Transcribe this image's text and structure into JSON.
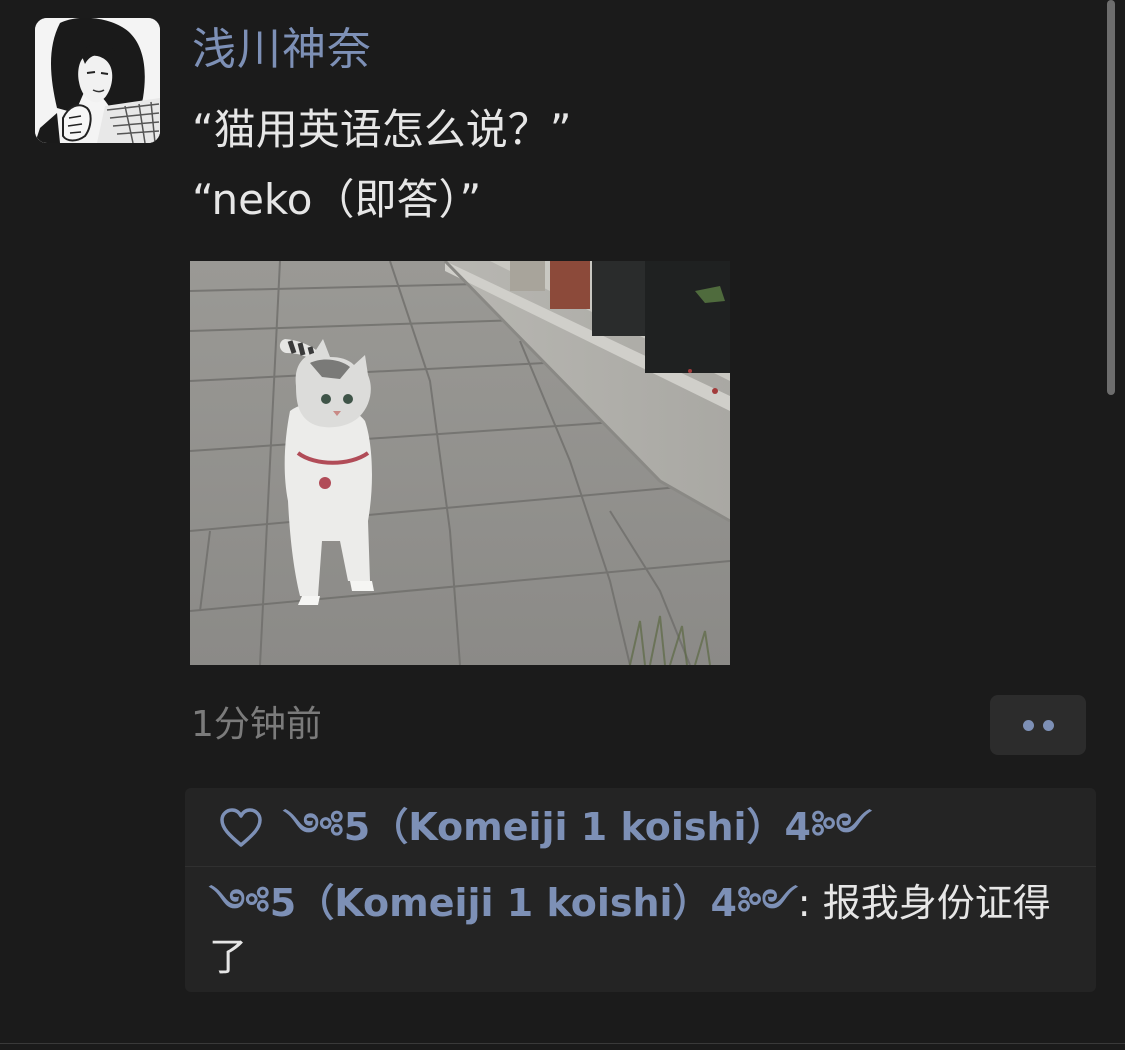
{
  "post": {
    "username": "浅川神奈",
    "text_lines": [
      "“猫用英语怎么说？”",
      "“neko（即答）”"
    ],
    "timestamp": "1分钟前",
    "more_icon": "more-dots-icon"
  },
  "interactions": {
    "like_icon": "heart-icon",
    "likes": [
      "༺5（Komeiji 1 koishi）4༻"
    ],
    "comments": [
      {
        "author": "༺5（Komeiji 1 koishi）4༻",
        "separator": ": ",
        "text": "报我身份证得了"
      }
    ]
  },
  "colors": {
    "background": "#1b1b1b",
    "accent": "#7d90b6",
    "text": "#e6e6e6",
    "muted": "#7b7b7b",
    "panel": "#242424"
  }
}
